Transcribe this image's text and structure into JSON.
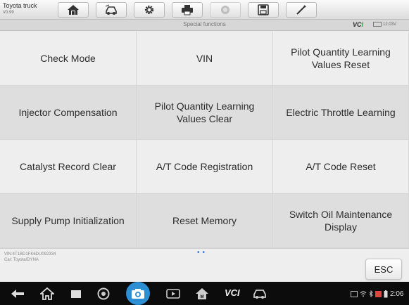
{
  "toolbar": {
    "vehicle": "Toyota truck",
    "version": "V0.99",
    "buttons": [
      {
        "name": "home-button",
        "icon": "home-icon"
      },
      {
        "name": "vehicle-swap-button",
        "icon": "car-swap-icon"
      },
      {
        "name": "settings-button",
        "icon": "gear-icon"
      },
      {
        "name": "print-button",
        "icon": "printer-icon"
      },
      {
        "name": "help-button",
        "icon": "help-icon"
      },
      {
        "name": "save-button",
        "icon": "save-icon"
      },
      {
        "name": "edit-button",
        "icon": "pen-icon"
      }
    ]
  },
  "subheader": {
    "title": "Special functions",
    "vci_logo": "VCI",
    "battery": "12.03V"
  },
  "functions": [
    [
      "Check Mode",
      "VIN",
      "Pilot Quantity Learning Values Reset"
    ],
    [
      "Injector Compensation",
      "Pilot Quantity Learning Values Clear",
      "Electric Throttle Learning"
    ],
    [
      "Catalyst Record Clear",
      "A/T Code Registration",
      "A/T Code Reset"
    ],
    [
      "Supply Pump Initialization",
      "Reset Memory",
      "Switch Oil Maintenance Display"
    ]
  ],
  "footer": {
    "vin": "VIN:4T1BD1FK6DU092334",
    "car": "Car: Toyota/DYNA",
    "esc_label": "ESC"
  },
  "navbar": {
    "vci_label": "VCI",
    "clock": "2:06"
  },
  "colors": {
    "accent": "#2d8fd3",
    "vci_green": "#3aa13a",
    "page_dot": "#3a6fd8"
  }
}
